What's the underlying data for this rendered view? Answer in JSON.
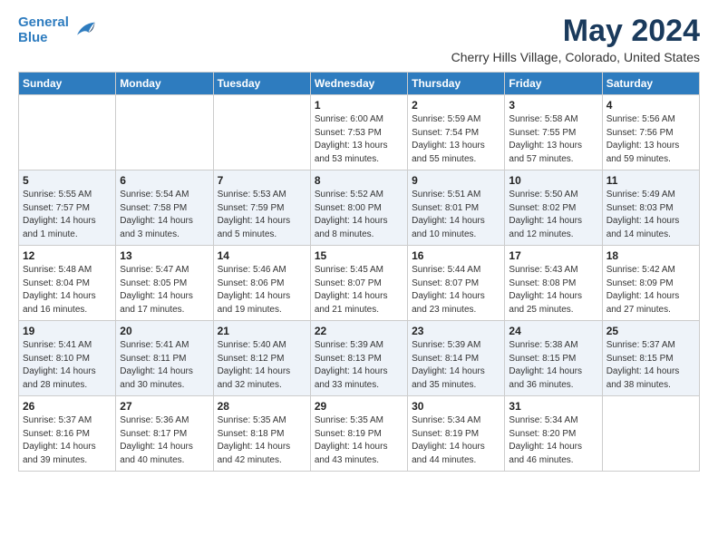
{
  "header": {
    "logo_line1": "General",
    "logo_line2": "Blue",
    "title": "May 2024",
    "subtitle": "Cherry Hills Village, Colorado, United States"
  },
  "days_of_week": [
    "Sunday",
    "Monday",
    "Tuesday",
    "Wednesday",
    "Thursday",
    "Friday",
    "Saturday"
  ],
  "weeks": [
    [
      {
        "num": "",
        "detail": ""
      },
      {
        "num": "",
        "detail": ""
      },
      {
        "num": "",
        "detail": ""
      },
      {
        "num": "1",
        "detail": "Sunrise: 6:00 AM\nSunset: 7:53 PM\nDaylight: 13 hours\nand 53 minutes."
      },
      {
        "num": "2",
        "detail": "Sunrise: 5:59 AM\nSunset: 7:54 PM\nDaylight: 13 hours\nand 55 minutes."
      },
      {
        "num": "3",
        "detail": "Sunrise: 5:58 AM\nSunset: 7:55 PM\nDaylight: 13 hours\nand 57 minutes."
      },
      {
        "num": "4",
        "detail": "Sunrise: 5:56 AM\nSunset: 7:56 PM\nDaylight: 13 hours\nand 59 minutes."
      }
    ],
    [
      {
        "num": "5",
        "detail": "Sunrise: 5:55 AM\nSunset: 7:57 PM\nDaylight: 14 hours\nand 1 minute."
      },
      {
        "num": "6",
        "detail": "Sunrise: 5:54 AM\nSunset: 7:58 PM\nDaylight: 14 hours\nand 3 minutes."
      },
      {
        "num": "7",
        "detail": "Sunrise: 5:53 AM\nSunset: 7:59 PM\nDaylight: 14 hours\nand 5 minutes."
      },
      {
        "num": "8",
        "detail": "Sunrise: 5:52 AM\nSunset: 8:00 PM\nDaylight: 14 hours\nand 8 minutes."
      },
      {
        "num": "9",
        "detail": "Sunrise: 5:51 AM\nSunset: 8:01 PM\nDaylight: 14 hours\nand 10 minutes."
      },
      {
        "num": "10",
        "detail": "Sunrise: 5:50 AM\nSunset: 8:02 PM\nDaylight: 14 hours\nand 12 minutes."
      },
      {
        "num": "11",
        "detail": "Sunrise: 5:49 AM\nSunset: 8:03 PM\nDaylight: 14 hours\nand 14 minutes."
      }
    ],
    [
      {
        "num": "12",
        "detail": "Sunrise: 5:48 AM\nSunset: 8:04 PM\nDaylight: 14 hours\nand 16 minutes."
      },
      {
        "num": "13",
        "detail": "Sunrise: 5:47 AM\nSunset: 8:05 PM\nDaylight: 14 hours\nand 17 minutes."
      },
      {
        "num": "14",
        "detail": "Sunrise: 5:46 AM\nSunset: 8:06 PM\nDaylight: 14 hours\nand 19 minutes."
      },
      {
        "num": "15",
        "detail": "Sunrise: 5:45 AM\nSunset: 8:07 PM\nDaylight: 14 hours\nand 21 minutes."
      },
      {
        "num": "16",
        "detail": "Sunrise: 5:44 AM\nSunset: 8:07 PM\nDaylight: 14 hours\nand 23 minutes."
      },
      {
        "num": "17",
        "detail": "Sunrise: 5:43 AM\nSunset: 8:08 PM\nDaylight: 14 hours\nand 25 minutes."
      },
      {
        "num": "18",
        "detail": "Sunrise: 5:42 AM\nSunset: 8:09 PM\nDaylight: 14 hours\nand 27 minutes."
      }
    ],
    [
      {
        "num": "19",
        "detail": "Sunrise: 5:41 AM\nSunset: 8:10 PM\nDaylight: 14 hours\nand 28 minutes."
      },
      {
        "num": "20",
        "detail": "Sunrise: 5:41 AM\nSunset: 8:11 PM\nDaylight: 14 hours\nand 30 minutes."
      },
      {
        "num": "21",
        "detail": "Sunrise: 5:40 AM\nSunset: 8:12 PM\nDaylight: 14 hours\nand 32 minutes."
      },
      {
        "num": "22",
        "detail": "Sunrise: 5:39 AM\nSunset: 8:13 PM\nDaylight: 14 hours\nand 33 minutes."
      },
      {
        "num": "23",
        "detail": "Sunrise: 5:39 AM\nSunset: 8:14 PM\nDaylight: 14 hours\nand 35 minutes."
      },
      {
        "num": "24",
        "detail": "Sunrise: 5:38 AM\nSunset: 8:15 PM\nDaylight: 14 hours\nand 36 minutes."
      },
      {
        "num": "25",
        "detail": "Sunrise: 5:37 AM\nSunset: 8:15 PM\nDaylight: 14 hours\nand 38 minutes."
      }
    ],
    [
      {
        "num": "26",
        "detail": "Sunrise: 5:37 AM\nSunset: 8:16 PM\nDaylight: 14 hours\nand 39 minutes."
      },
      {
        "num": "27",
        "detail": "Sunrise: 5:36 AM\nSunset: 8:17 PM\nDaylight: 14 hours\nand 40 minutes."
      },
      {
        "num": "28",
        "detail": "Sunrise: 5:35 AM\nSunset: 8:18 PM\nDaylight: 14 hours\nand 42 minutes."
      },
      {
        "num": "29",
        "detail": "Sunrise: 5:35 AM\nSunset: 8:19 PM\nDaylight: 14 hours\nand 43 minutes."
      },
      {
        "num": "30",
        "detail": "Sunrise: 5:34 AM\nSunset: 8:19 PM\nDaylight: 14 hours\nand 44 minutes."
      },
      {
        "num": "31",
        "detail": "Sunrise: 5:34 AM\nSunset: 8:20 PM\nDaylight: 14 hours\nand 46 minutes."
      },
      {
        "num": "",
        "detail": ""
      }
    ]
  ]
}
